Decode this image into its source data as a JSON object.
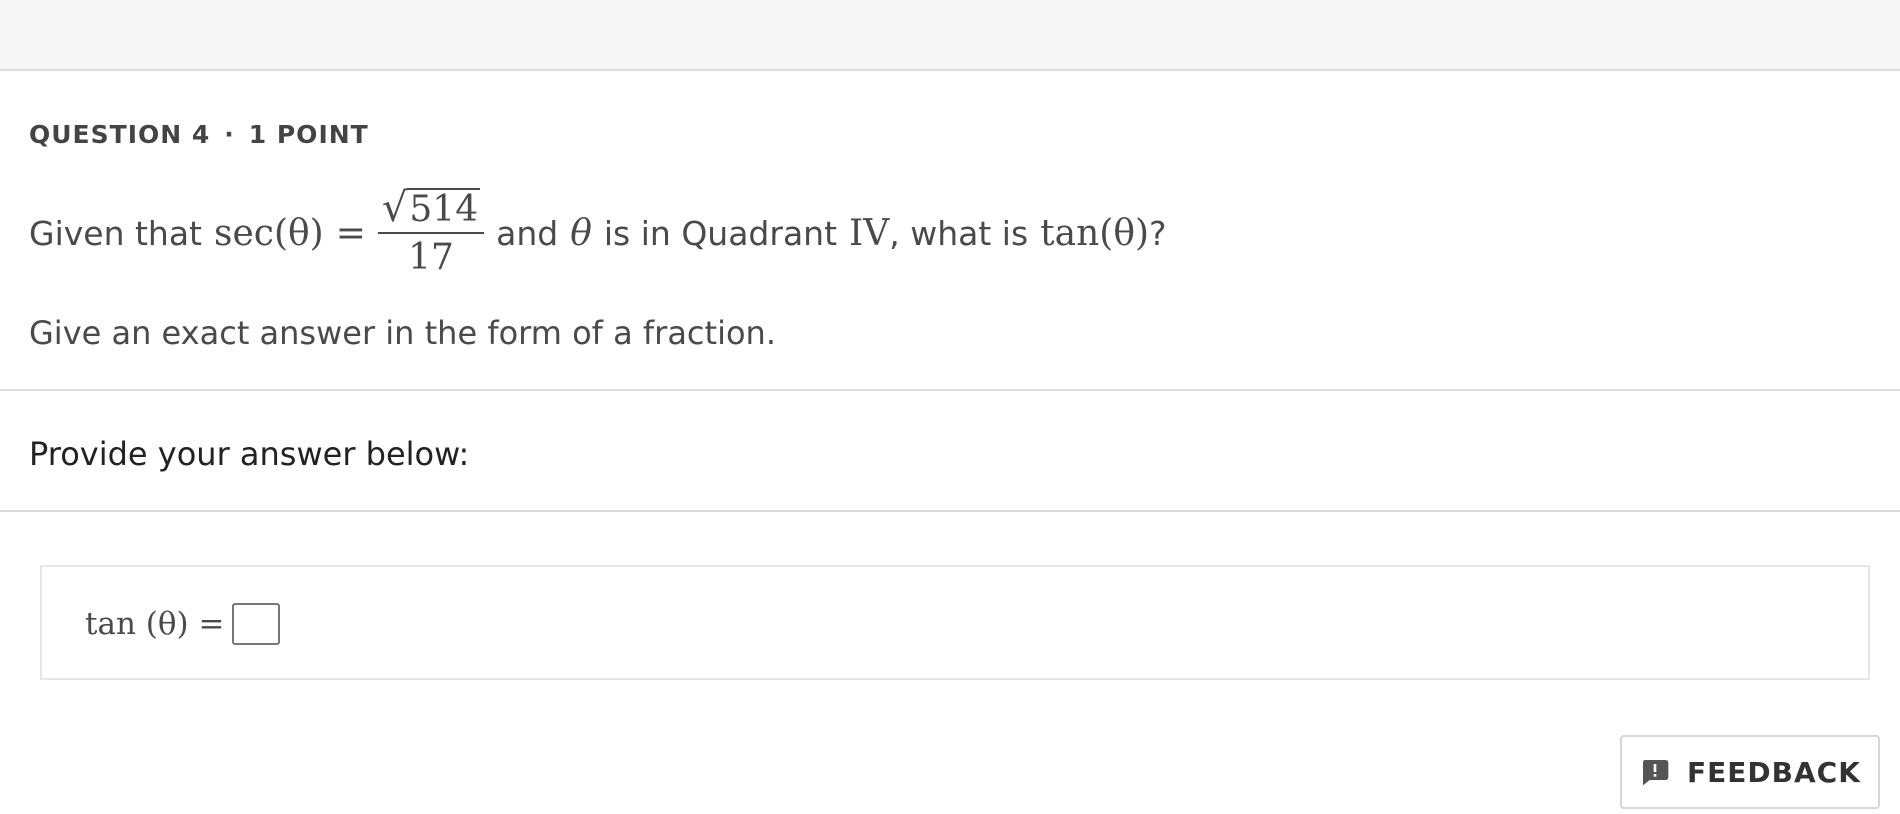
{
  "question": {
    "number_label": "QUESTION 4",
    "separator": "·",
    "points_label": "1 POINT",
    "prompt": {
      "given_text": "Given that",
      "sec_expr": "sec(θ)",
      "equals": "=",
      "sqrt_value": "514",
      "sqrt_symbol": "√",
      "denominator": "17",
      "and_text": "and",
      "theta": "θ",
      "quadrant_text": "is in Quadrant",
      "quadrant_numeral": "IV",
      "what_text": ", what is",
      "tan_expr": "tan(θ)",
      "question_mark": "?"
    },
    "instruction": "Give an exact answer in the form of a fraction."
  },
  "answer_section": {
    "label": "Provide your answer below:",
    "expression": "tan (θ) =",
    "input_value": ""
  },
  "feedback": {
    "label": "FEEDBACK",
    "icon": "feedback-icon"
  }
}
